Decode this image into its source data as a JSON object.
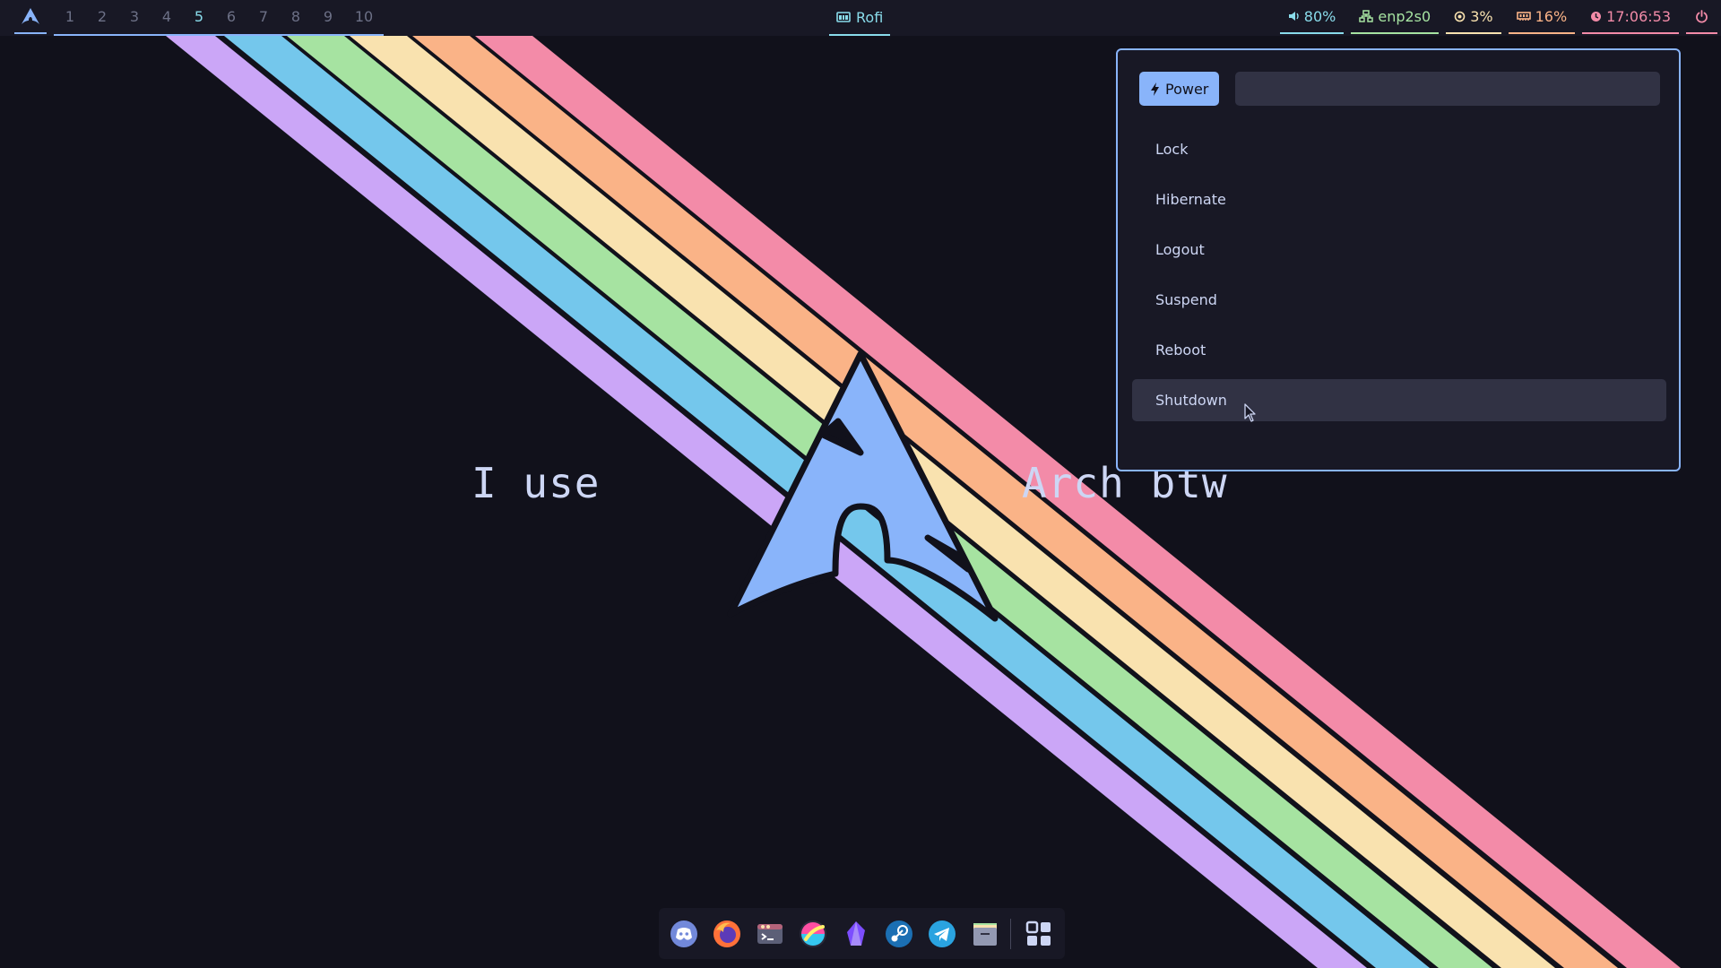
{
  "wallpaper": {
    "text_left": "I use",
    "text_right": "Arch btw"
  },
  "topbar": {
    "logo_icon": "arch-logo-icon",
    "workspaces": [
      "1",
      "2",
      "3",
      "4",
      "5",
      "6",
      "7",
      "8",
      "9",
      "10"
    ],
    "active_workspace": "5",
    "window_title": "Rofi",
    "modules": {
      "volume": "80%",
      "network": "enp2s0",
      "cpu": "3%",
      "memory": "16%",
      "clock": "17:06:53",
      "power_icon": "power-icon"
    }
  },
  "rofi": {
    "prompt": "Power",
    "input_value": "",
    "items": [
      "Lock",
      "Hibernate",
      "Logout",
      "Suspend",
      "Reboot",
      "Shutdown"
    ],
    "selected": "Shutdown"
  },
  "dock": {
    "apps": [
      "discord-icon",
      "firefox-icon",
      "terminal-icon",
      "krita-icon",
      "obsidian-icon",
      "steam-icon",
      "telegram-icon",
      "file-manager-icon",
      "app-grid-icon"
    ]
  },
  "colors": {
    "base": "#11111b",
    "mantle": "#181825",
    "surface": "#313244",
    "text": "#cdd6f4",
    "blue": "#89b4fa",
    "sky": "#89dceb",
    "green": "#a6e3a1",
    "yellow": "#f9e2af",
    "peach": "#fab387",
    "pink": "#f38ba8",
    "mauve": "#cba6f7",
    "lavender": "#d0a6f7"
  }
}
